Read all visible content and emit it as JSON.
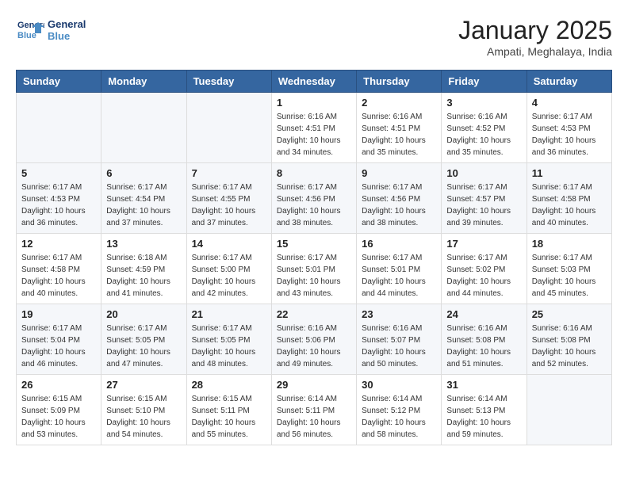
{
  "header": {
    "logo_line1": "General",
    "logo_line2": "Blue",
    "month_title": "January 2025",
    "location": "Ampati, Meghalaya, India"
  },
  "weekdays": [
    "Sunday",
    "Monday",
    "Tuesday",
    "Wednesday",
    "Thursday",
    "Friday",
    "Saturday"
  ],
  "weeks": [
    [
      {
        "day": "",
        "sunrise": "",
        "sunset": "",
        "daylight": ""
      },
      {
        "day": "",
        "sunrise": "",
        "sunset": "",
        "daylight": ""
      },
      {
        "day": "",
        "sunrise": "",
        "sunset": "",
        "daylight": ""
      },
      {
        "day": "1",
        "sunrise": "Sunrise: 6:16 AM",
        "sunset": "Sunset: 4:51 PM",
        "daylight": "Daylight: 10 hours and 34 minutes."
      },
      {
        "day": "2",
        "sunrise": "Sunrise: 6:16 AM",
        "sunset": "Sunset: 4:51 PM",
        "daylight": "Daylight: 10 hours and 35 minutes."
      },
      {
        "day": "3",
        "sunrise": "Sunrise: 6:16 AM",
        "sunset": "Sunset: 4:52 PM",
        "daylight": "Daylight: 10 hours and 35 minutes."
      },
      {
        "day": "4",
        "sunrise": "Sunrise: 6:17 AM",
        "sunset": "Sunset: 4:53 PM",
        "daylight": "Daylight: 10 hours and 36 minutes."
      }
    ],
    [
      {
        "day": "5",
        "sunrise": "Sunrise: 6:17 AM",
        "sunset": "Sunset: 4:53 PM",
        "daylight": "Daylight: 10 hours and 36 minutes."
      },
      {
        "day": "6",
        "sunrise": "Sunrise: 6:17 AM",
        "sunset": "Sunset: 4:54 PM",
        "daylight": "Daylight: 10 hours and 37 minutes."
      },
      {
        "day": "7",
        "sunrise": "Sunrise: 6:17 AM",
        "sunset": "Sunset: 4:55 PM",
        "daylight": "Daylight: 10 hours and 37 minutes."
      },
      {
        "day": "8",
        "sunrise": "Sunrise: 6:17 AM",
        "sunset": "Sunset: 4:56 PM",
        "daylight": "Daylight: 10 hours and 38 minutes."
      },
      {
        "day": "9",
        "sunrise": "Sunrise: 6:17 AM",
        "sunset": "Sunset: 4:56 PM",
        "daylight": "Daylight: 10 hours and 38 minutes."
      },
      {
        "day": "10",
        "sunrise": "Sunrise: 6:17 AM",
        "sunset": "Sunset: 4:57 PM",
        "daylight": "Daylight: 10 hours and 39 minutes."
      },
      {
        "day": "11",
        "sunrise": "Sunrise: 6:17 AM",
        "sunset": "Sunset: 4:58 PM",
        "daylight": "Daylight: 10 hours and 40 minutes."
      }
    ],
    [
      {
        "day": "12",
        "sunrise": "Sunrise: 6:17 AM",
        "sunset": "Sunset: 4:58 PM",
        "daylight": "Daylight: 10 hours and 40 minutes."
      },
      {
        "day": "13",
        "sunrise": "Sunrise: 6:18 AM",
        "sunset": "Sunset: 4:59 PM",
        "daylight": "Daylight: 10 hours and 41 minutes."
      },
      {
        "day": "14",
        "sunrise": "Sunrise: 6:17 AM",
        "sunset": "Sunset: 5:00 PM",
        "daylight": "Daylight: 10 hours and 42 minutes."
      },
      {
        "day": "15",
        "sunrise": "Sunrise: 6:17 AM",
        "sunset": "Sunset: 5:01 PM",
        "daylight": "Daylight: 10 hours and 43 minutes."
      },
      {
        "day": "16",
        "sunrise": "Sunrise: 6:17 AM",
        "sunset": "Sunset: 5:01 PM",
        "daylight": "Daylight: 10 hours and 44 minutes."
      },
      {
        "day": "17",
        "sunrise": "Sunrise: 6:17 AM",
        "sunset": "Sunset: 5:02 PM",
        "daylight": "Daylight: 10 hours and 44 minutes."
      },
      {
        "day": "18",
        "sunrise": "Sunrise: 6:17 AM",
        "sunset": "Sunset: 5:03 PM",
        "daylight": "Daylight: 10 hours and 45 minutes."
      }
    ],
    [
      {
        "day": "19",
        "sunrise": "Sunrise: 6:17 AM",
        "sunset": "Sunset: 5:04 PM",
        "daylight": "Daylight: 10 hours and 46 minutes."
      },
      {
        "day": "20",
        "sunrise": "Sunrise: 6:17 AM",
        "sunset": "Sunset: 5:05 PM",
        "daylight": "Daylight: 10 hours and 47 minutes."
      },
      {
        "day": "21",
        "sunrise": "Sunrise: 6:17 AM",
        "sunset": "Sunset: 5:05 PM",
        "daylight": "Daylight: 10 hours and 48 minutes."
      },
      {
        "day": "22",
        "sunrise": "Sunrise: 6:16 AM",
        "sunset": "Sunset: 5:06 PM",
        "daylight": "Daylight: 10 hours and 49 minutes."
      },
      {
        "day": "23",
        "sunrise": "Sunrise: 6:16 AM",
        "sunset": "Sunset: 5:07 PM",
        "daylight": "Daylight: 10 hours and 50 minutes."
      },
      {
        "day": "24",
        "sunrise": "Sunrise: 6:16 AM",
        "sunset": "Sunset: 5:08 PM",
        "daylight": "Daylight: 10 hours and 51 minutes."
      },
      {
        "day": "25",
        "sunrise": "Sunrise: 6:16 AM",
        "sunset": "Sunset: 5:08 PM",
        "daylight": "Daylight: 10 hours and 52 minutes."
      }
    ],
    [
      {
        "day": "26",
        "sunrise": "Sunrise: 6:15 AM",
        "sunset": "Sunset: 5:09 PM",
        "daylight": "Daylight: 10 hours and 53 minutes."
      },
      {
        "day": "27",
        "sunrise": "Sunrise: 6:15 AM",
        "sunset": "Sunset: 5:10 PM",
        "daylight": "Daylight: 10 hours and 54 minutes."
      },
      {
        "day": "28",
        "sunrise": "Sunrise: 6:15 AM",
        "sunset": "Sunset: 5:11 PM",
        "daylight": "Daylight: 10 hours and 55 minutes."
      },
      {
        "day": "29",
        "sunrise": "Sunrise: 6:14 AM",
        "sunset": "Sunset: 5:11 PM",
        "daylight": "Daylight: 10 hours and 56 minutes."
      },
      {
        "day": "30",
        "sunrise": "Sunrise: 6:14 AM",
        "sunset": "Sunset: 5:12 PM",
        "daylight": "Daylight: 10 hours and 58 minutes."
      },
      {
        "day": "31",
        "sunrise": "Sunrise: 6:14 AM",
        "sunset": "Sunset: 5:13 PM",
        "daylight": "Daylight: 10 hours and 59 minutes."
      },
      {
        "day": "",
        "sunrise": "",
        "sunset": "",
        "daylight": ""
      }
    ]
  ]
}
